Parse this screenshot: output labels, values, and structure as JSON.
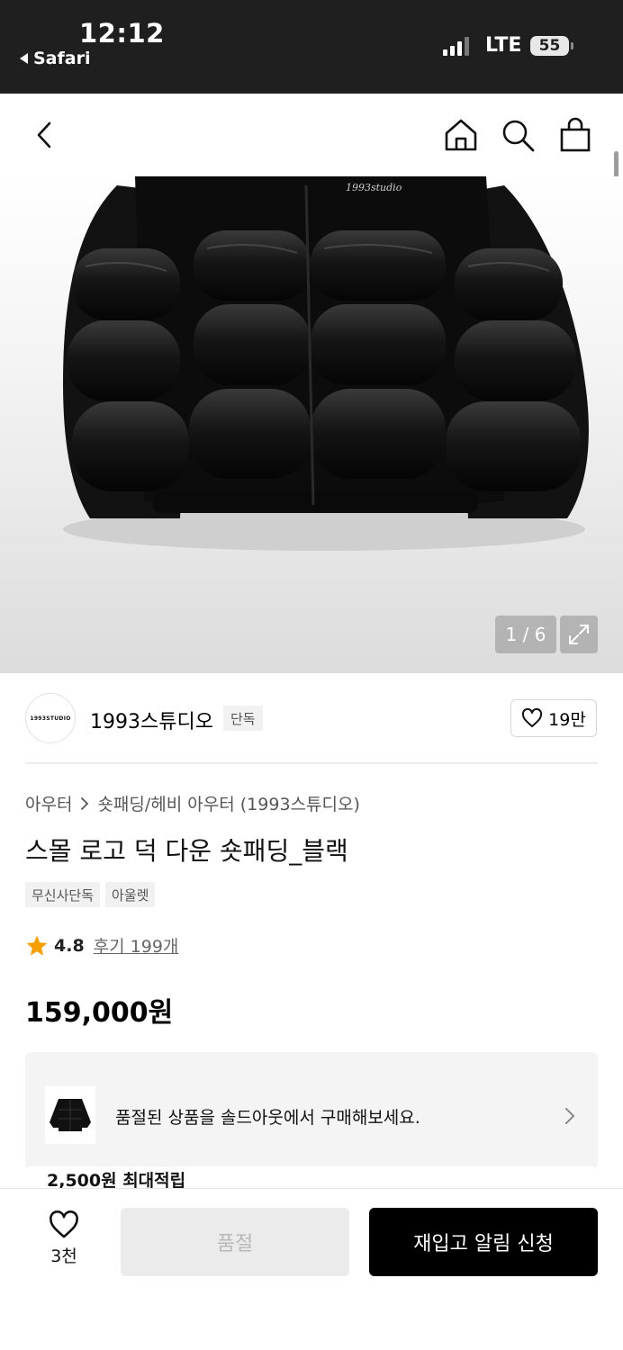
{
  "status_bar": {
    "time": "12:12",
    "back_app": "Safari",
    "network": "LTE",
    "battery": "55"
  },
  "nav": {
    "icons": [
      "back-arrow-icon",
      "home-icon",
      "search-icon",
      "shopping-bag-icon"
    ]
  },
  "gallery": {
    "counter": "1 / 6",
    "jacket_logo": "1993studio"
  },
  "brand": {
    "logo_text": "1993STUDIO",
    "name": "1993스튜디오",
    "badge": "단독",
    "likes": "19만"
  },
  "product": {
    "breadcrumb": [
      "아우터",
      "숏패딩/헤비 아우터 (1993스튜디오)"
    ],
    "title": "스몰 로고 덕 다운 숏패딩_블랙",
    "tags": [
      "무신사단독",
      "아울렛"
    ],
    "rating": "4.8",
    "review_link": "후기 199개",
    "price": "159,000원"
  },
  "soldout_card": {
    "text": "품절된 상품을 솔드아웃에서 구매해보세요.",
    "points": "2,500원 최대적립"
  },
  "bottom_bar": {
    "like_count": "3천",
    "soldout_label": "품절",
    "restock_label": "재입고 알림 신청"
  },
  "colors": {
    "status_bar_bg": "#1f1f1f",
    "star": "#f5a000",
    "primary_button": "#000000",
    "disabled_button": "#ebebeb"
  }
}
